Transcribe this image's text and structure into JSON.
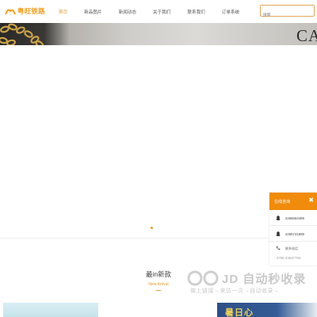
{
  "header": {
    "logo_text": "粤旺铁路",
    "nav": [
      {
        "label": "首页",
        "active": true
      },
      {
        "label": "新品图片",
        "active": false
      },
      {
        "label": "新闻动态",
        "active": false
      },
      {
        "label": "关于我们",
        "active": false
      },
      {
        "label": "联系我们",
        "active": false
      },
      {
        "label": "订单系统",
        "active": false
      }
    ],
    "search_placeholder": "搜索"
  },
  "hero": {
    "brand_text": "CA"
  },
  "carousel": {
    "dot_count": 1,
    "active_index": 0
  },
  "section": {
    "title": "最in新款",
    "subtitle": "New Arrival"
  },
  "card_right": {
    "text": "暑日心"
  },
  "service_widget": {
    "title": "在线咨询",
    "close_glyph": "✖",
    "qq": [
      "2265664499",
      "2265741699"
    ],
    "phone_label": "联系电话",
    "phone": "0755-23537793"
  },
  "watermark": {
    "main": "JD 自动秒收录",
    "sub": "做上链接→来访一次→自动收录→"
  },
  "colors": {
    "accent": "#e89a2c",
    "widget_header": "#f08b0c"
  }
}
